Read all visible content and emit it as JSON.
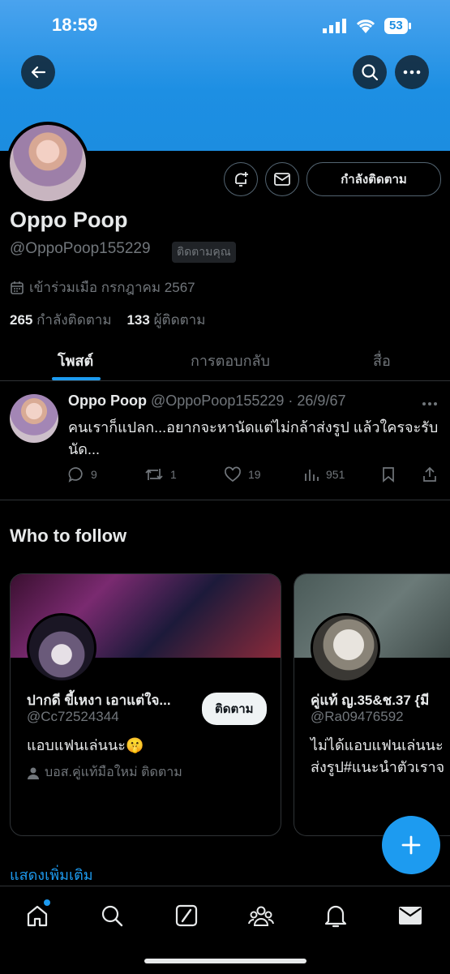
{
  "status_bar": {
    "time": "18:59",
    "battery": "53"
  },
  "profile": {
    "name": "Oppo Poop",
    "handle": "@OppoPoop155229",
    "follows_you": "ติดตามคุณ",
    "joined": "เข้าร่วมเมือ กรกฎาคม 2567",
    "following_count": "265",
    "following_label": "กำลังติดตาม",
    "followers_count": "133",
    "followers_label": "ผู้ติดตาม",
    "follow_button": "กำลังติดตาม"
  },
  "tabs": [
    {
      "label": "โพสต์"
    },
    {
      "label": "การตอบกลับ"
    },
    {
      "label": "สื่อ"
    }
  ],
  "post": {
    "name": "Oppo Poop",
    "meta": "@OppoPoop155229 · 26/9/67",
    "text": "คนเราก็แปลก...อยากจะหานัดแต่ไม่กล้าส่งรูป แล้วใครจะรับนัด...",
    "replies": "9",
    "reposts": "1",
    "likes": "19",
    "views": "951"
  },
  "who_to_follow": {
    "title": "Who to follow",
    "cards": [
      {
        "name": "ปากดี ขี้เหงา เอาแต่ใจ...",
        "handle": "@Cc72524344",
        "bio": "แอบแฟนเล่นนะ🤫",
        "context": "บอส.คู่แท้มือใหม่ ติดตาม",
        "button": "ติดตาม"
      },
      {
        "name": "คู่แท้ ญ.35&ช.37 {มี",
        "handle": "@Ra09476592",
        "bio": "ไม่ได้แอบแฟนเล่นนะ",
        "bio2": "ส่งรูป#แนะนำตัวเราจ"
      }
    ],
    "show_more": "แสดงเพิ่มเติม"
  },
  "colors": {
    "accent": "#1d9bf0",
    "banner": "#1d8fe3"
  }
}
